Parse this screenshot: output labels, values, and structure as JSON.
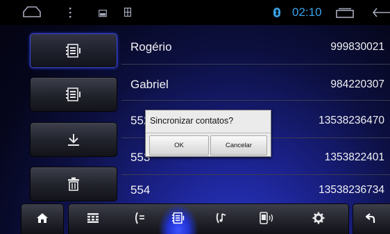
{
  "status_bar": {
    "time": "02:10",
    "icons": [
      "home-outline-icon",
      "dots-icon",
      "screen-icon",
      "image-icon",
      "bluetooth-icon",
      "recent-apps-icon",
      "back-arrow-icon"
    ]
  },
  "sidebar": {
    "buttons": [
      {
        "name": "contacts-icon",
        "active": true
      },
      {
        "name": "contacts-icon",
        "active": false
      },
      {
        "name": "download-icon",
        "active": false
      },
      {
        "name": "trash-icon",
        "active": false
      }
    ]
  },
  "contacts": [
    {
      "name": "Rogério",
      "phone": "999830021"
    },
    {
      "name": "Gabriel",
      "phone": "984220307"
    },
    {
      "name": "552",
      "phone": "13538236470"
    },
    {
      "name": "553",
      "phone": "1353822401"
    },
    {
      "name": "554",
      "phone": "13538236734"
    }
  ],
  "dialog": {
    "message": "Sincronizar contatos?",
    "ok_label": "OK",
    "cancel_label": "Cancelar"
  },
  "bottom_bar": {
    "items": [
      "home-icon",
      "keypad-icon",
      "call-log-icon",
      "contacts-icon",
      "music-phone-icon",
      "phone-audio-icon",
      "settings-icon",
      "back-icon"
    ],
    "selected": "contacts-icon"
  },
  "colors": {
    "accent": "#3aa3e8",
    "selected_glow": "#3b52ff",
    "active_border": "#3846d8"
  }
}
